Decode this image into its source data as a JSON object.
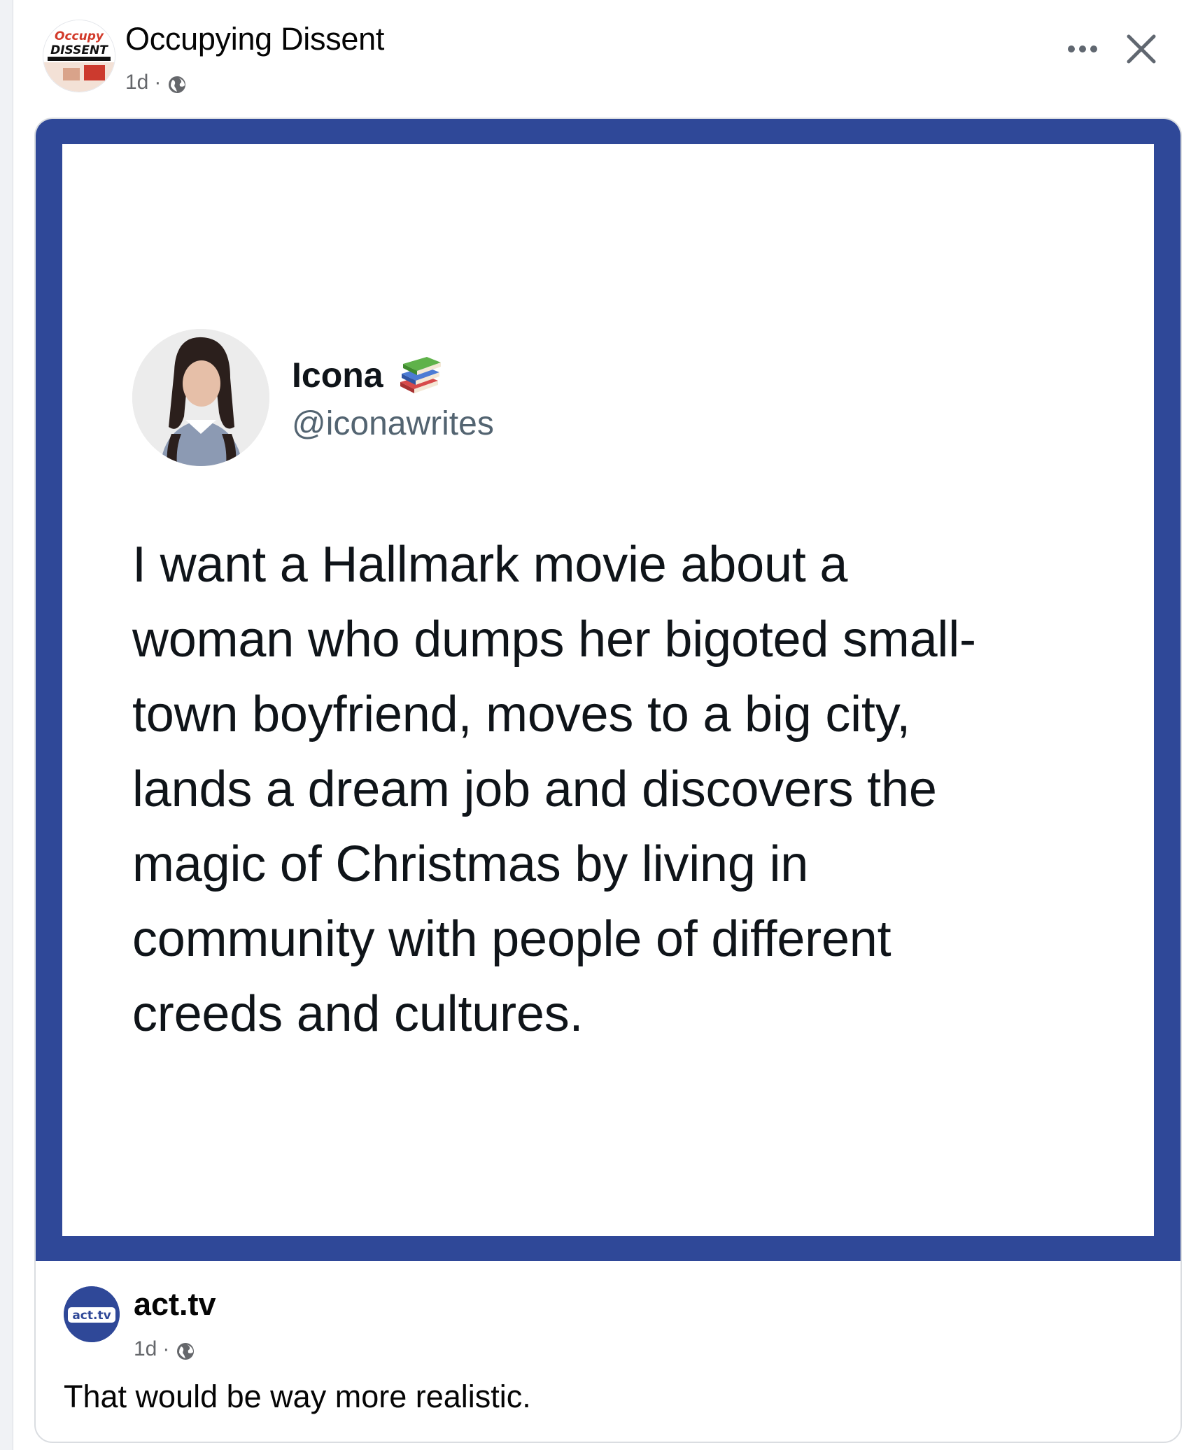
{
  "post": {
    "page_name": "Occupying Dissent",
    "timestamp": "1d",
    "separator": "·",
    "logo_text_top": "Occupy",
    "logo_text_bottom": "DISSENT"
  },
  "actions": {
    "more_icon": "more-horizontal-icon",
    "close_icon": "close-icon"
  },
  "tweet": {
    "name": "Icona",
    "handle": "@iconawrites",
    "name_emoji_icon": "books-icon",
    "text_lines": [
      "I want a Hallmark movie about a",
      "woman who dumps her bigoted small-",
      "town boyfriend, moves to a big city,",
      "lands a dream job and discovers the",
      "magic of Christmas by living in",
      "community with people of different",
      "creeds and cultures."
    ]
  },
  "shared_from": {
    "name": "act.tv",
    "logo_text": "act.tv",
    "timestamp": "1d",
    "separator": "·",
    "caption": "That would be way more realistic."
  },
  "colors": {
    "frame_blue": "#2f4898",
    "meta_gray": "#65676b",
    "background": "#f0f2f5"
  }
}
